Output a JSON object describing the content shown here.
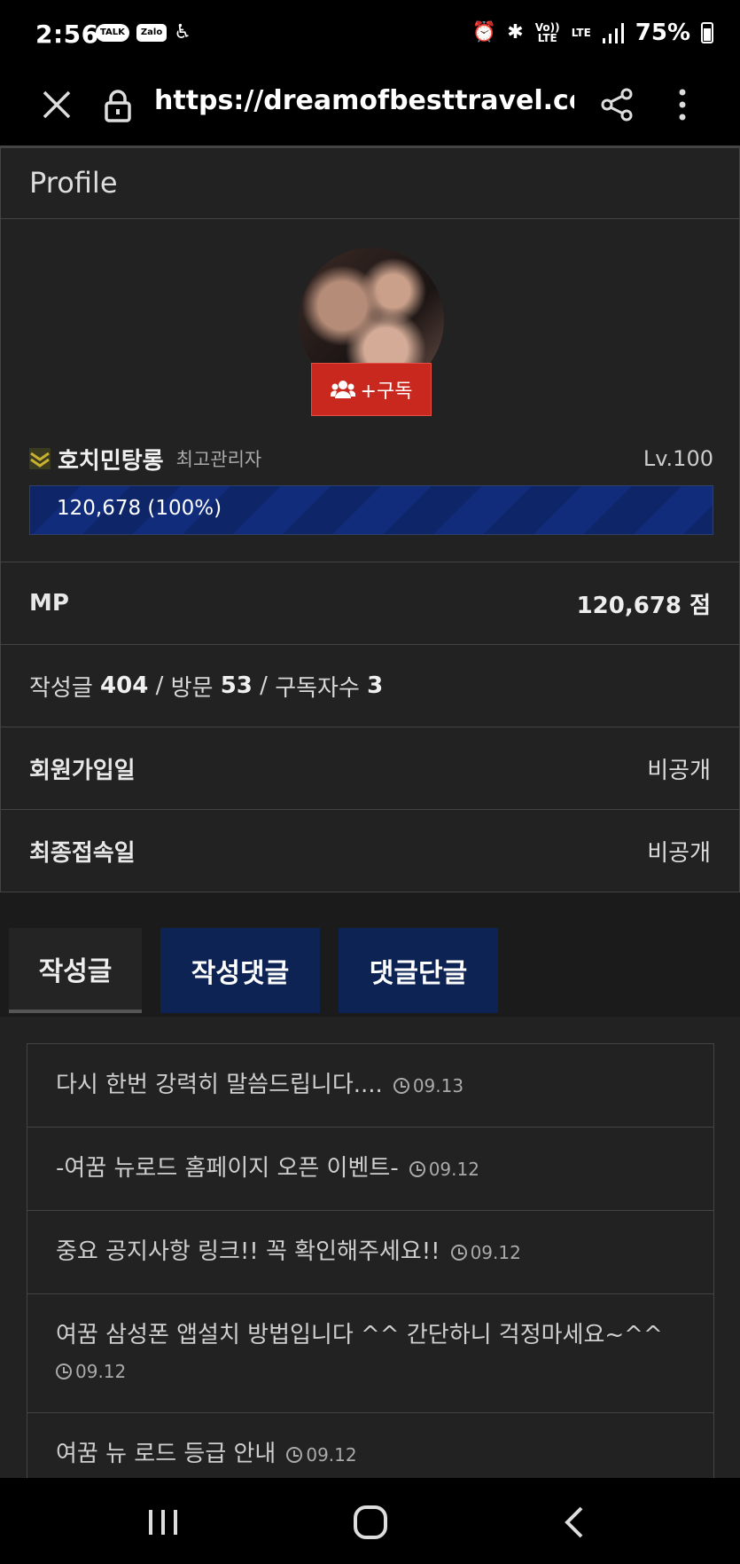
{
  "status_bar": {
    "time": "2:56",
    "app_icons": [
      "TALK",
      "Zalo"
    ],
    "network_volte": "Vo)) LTE",
    "network_lte": "LTE",
    "battery": "75%"
  },
  "browser": {
    "url": "https://dreamofbesttravel.com/l"
  },
  "profile": {
    "title": "Profile",
    "subscribe_label": "+구독",
    "nickname": "호치민탕롱",
    "role": "최고관리자",
    "level": "Lv.100",
    "xp_text": "120,678 (100%)",
    "xp_fraction": 1.0,
    "mp_label": "MP",
    "mp_value": "120,678 점",
    "stats": {
      "posts_label": "작성글",
      "posts": "404",
      "visits_label": "방문",
      "visits": "53",
      "subs_label": "구독자수",
      "subs": "3",
      "sep": "/"
    },
    "join_label": "회원가입일",
    "join_value": "비공개",
    "last_label": "최종접속일",
    "last_value": "비공개"
  },
  "tabs": [
    {
      "label": "작성글"
    },
    {
      "label": "작성댓글"
    },
    {
      "label": "댓글단글"
    }
  ],
  "posts": [
    {
      "title": "다시 한번 강력히 말씀드립니다....",
      "date": "09.13"
    },
    {
      "title": "-여꿈 뉴로드 홈페이지 오픈 이벤트-",
      "date": "09.12"
    },
    {
      "title": "중요 공지사항 링크!! 꼭 확인해주세요!!",
      "date": "09.12"
    },
    {
      "title": "여꿈 삼성폰 앱설치 방법입니다 ^^ 간단하니 걱정마세요~^^",
      "date": "09.12"
    },
    {
      "title": "여꿈 뉴 로드 등급 안내",
      "date": "09.12"
    }
  ],
  "colors": {
    "subscribe_button": "#c8281e",
    "xp_bar": "#0e2568",
    "tab_blue": "#0c2353"
  }
}
